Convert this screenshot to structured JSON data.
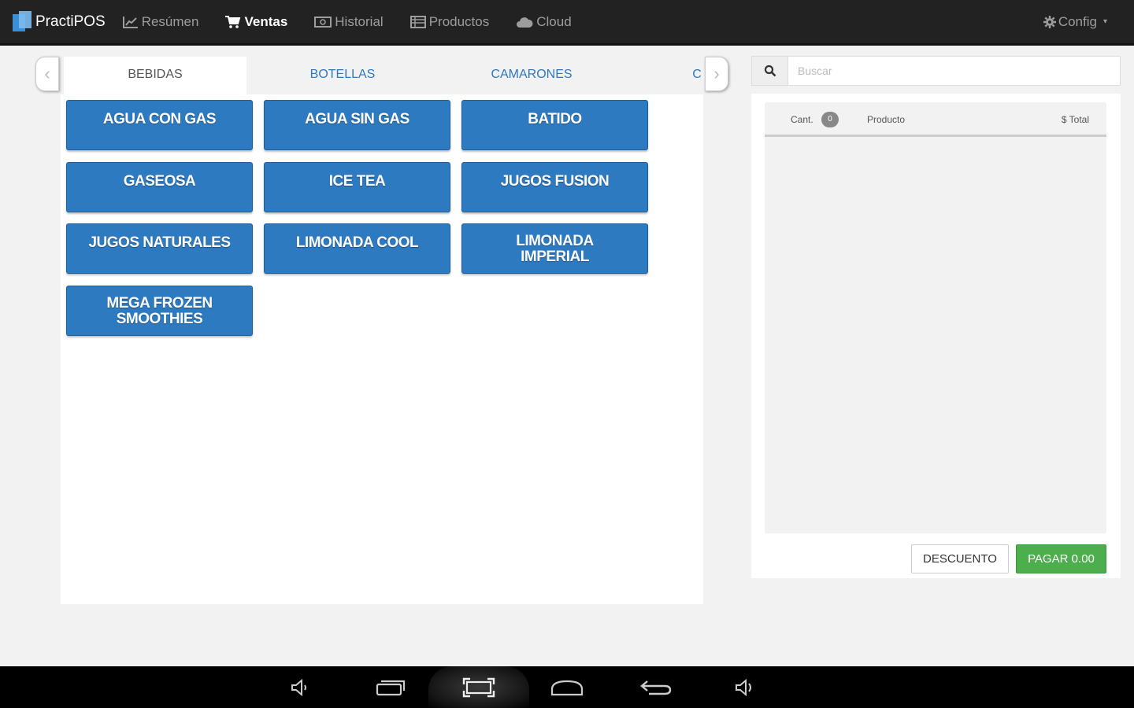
{
  "app": {
    "brand": "PractiPOS"
  },
  "nav": {
    "items": [
      {
        "label": "Resúmen",
        "icon": "chart-icon",
        "active": false
      },
      {
        "label": "Ventas",
        "icon": "cart-icon",
        "active": true
      },
      {
        "label": "Historial",
        "icon": "money-icon",
        "active": false
      },
      {
        "label": "Productos",
        "icon": "list-icon",
        "active": false
      },
      {
        "label": "Cloud",
        "icon": "cloud-icon",
        "active": false
      }
    ],
    "config": "Config"
  },
  "tabs": [
    "BEBIDAS",
    "BOTELLAS",
    "CAMARONES",
    "C"
  ],
  "products": [
    "AGUA CON GAS",
    "AGUA SIN GAS",
    "BATIDO",
    "GASEOSA",
    "ICE TEA",
    "JUGOS FUSION",
    "JUGOS NATURALES",
    "LIMONADA COOL",
    "LIMONADA IMPERIAL",
    "MEGA FROZEN SMOOTHIES"
  ],
  "search": {
    "placeholder": "Buscar"
  },
  "order": {
    "col_qty": "Cant.",
    "count": "0",
    "col_product": "Producto",
    "col_total": "$ Total"
  },
  "actions": {
    "discount": "DESCUENTO",
    "pay": "PAGAR 0.00"
  },
  "colors": {
    "primary": "#2e7ac0",
    "success": "#4cae4c",
    "navbar": "#222222"
  }
}
